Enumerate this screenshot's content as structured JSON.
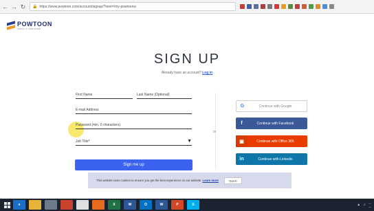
{
  "browser": {
    "back_icon": "back-arrow-icon",
    "forward_icon": "forward-arrow-icon",
    "reload_icon": "reload-icon",
    "url": "https://www.powtoon.com/account/signup/?next=/my-powtoons/",
    "extension_colors": [
      "#cf3a35",
      "#3e5fb0",
      "#5a6fa8",
      "#b03b3b",
      "#7a7a7a",
      "#d3393b",
      "#e6a01e",
      "#5d8a3c",
      "#c13c3c",
      "#d25b3a",
      "#4a9d4a",
      "#e28a2a",
      "#4d8fd6",
      "#888888"
    ]
  },
  "header": {
    "logo_text": "POWTOON",
    "logo_tagline": "MAKE IT AWESOME",
    "brand_colors": {
      "navy": "#2a3f8f",
      "orange": "#f7941d"
    }
  },
  "signup": {
    "title": "SIGN UP",
    "have_account": "Already have an account?",
    "login_link": "Log in",
    "first_name": "First Name",
    "last_name": "Last Name (Optional)",
    "email": "E-mail Address",
    "password": "Password (min. 6 characters)",
    "job_title": "Job Title*",
    "submit": "Sign me up",
    "or_label": "or",
    "accent_color": "#3b63f0"
  },
  "social": {
    "google": "Continue with Google",
    "facebook": "Continue with Facebook",
    "office": "Continue with Office 365",
    "linkedin": "Continue with Linkedin"
  },
  "cookie": {
    "text": "This website uses cookies to ensure you get the best experience on our website.",
    "learn_more": "Learn more",
    "button": "Got it!"
  },
  "taskbar": {
    "apps": [
      {
        "name": "internet-explorer",
        "glyph": "e",
        "color": "#1a6fc6"
      },
      {
        "name": "file-explorer",
        "glyph": "",
        "color": "#e8b339"
      },
      {
        "name": "media",
        "glyph": "",
        "color": "#6c7a89"
      },
      {
        "name": "store",
        "glyph": "",
        "color": "#c9422e"
      },
      {
        "name": "chrome",
        "glyph": "",
        "color": "#e0e0e0"
      },
      {
        "name": "firefox",
        "glyph": "",
        "color": "#e86a1c"
      },
      {
        "name": "excel",
        "glyph": "X",
        "color": "#1f7244"
      },
      {
        "name": "word",
        "glyph": "W",
        "color": "#2b5797"
      },
      {
        "name": "outlook",
        "glyph": "O",
        "color": "#0072c6"
      },
      {
        "name": "word-2",
        "glyph": "W",
        "color": "#2b5797"
      },
      {
        "name": "powerpoint",
        "glyph": "P",
        "color": "#d24726"
      },
      {
        "name": "skype",
        "glyph": "S",
        "color": "#00aff0"
      }
    ]
  }
}
